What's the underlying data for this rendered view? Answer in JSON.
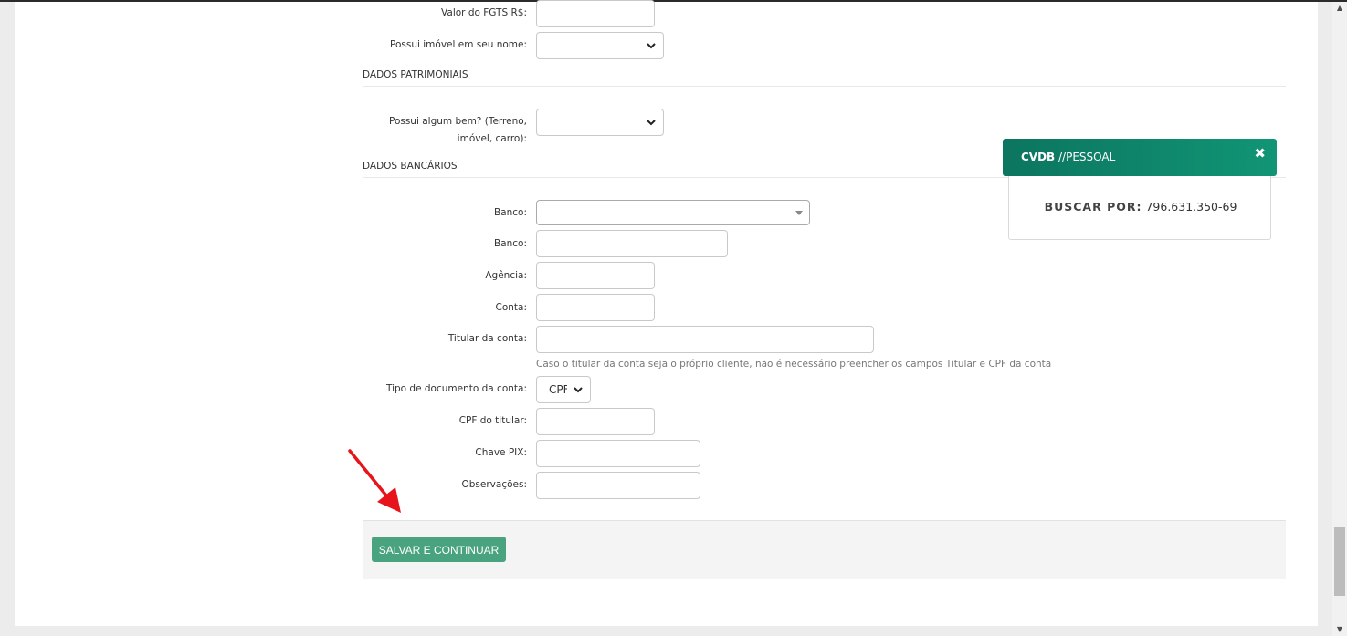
{
  "form": {
    "fgts_label": "Valor do FGTS R$:",
    "fgts_value": "",
    "imovel_label": "Possui imóvel em seu nome:",
    "imovel_value": "",
    "section_patrimoniais": "DADOS PATRIMONIAIS",
    "bem_label_line1": "Possui algum bem? (Terreno,",
    "bem_label_line2": "imóvel, carro):",
    "bem_value": "",
    "section_bancarios": "DADOS BANCÁRIOS",
    "banco_select_label": "Banco:",
    "banco_select_value": "",
    "banco_label": "Banco:",
    "banco_value": "",
    "agencia_label": "Agência:",
    "agencia_value": "",
    "conta_label": "Conta:",
    "conta_value": "",
    "titular_label": "Titular da conta:",
    "titular_value": "",
    "titular_hint": "Caso o titular da conta seja o próprio cliente, não é necessário preencher os campos Titular e CPF da conta",
    "tipo_doc_label": "Tipo de documento da conta:",
    "tipo_doc_value": "CPF",
    "cpf_titular_label": "CPF do titular:",
    "cpf_titular_value": "",
    "pix_label": "Chave PIX:",
    "pix_value": "",
    "obs_label": "Observações:",
    "obs_value": ""
  },
  "actions": {
    "save_label": "SALVAR E CONTINUAR"
  },
  "popup": {
    "title_bold": "CVDB",
    "title_rest": " //PESSOAL",
    "close_glyph": "✖",
    "search_key": "BUSCAR POR:",
    "search_value": "796.631.350-69"
  },
  "colors": {
    "save_button": "#4aa37f",
    "popup_header": "#0c7560",
    "annotation_arrow": "#e8141b"
  }
}
